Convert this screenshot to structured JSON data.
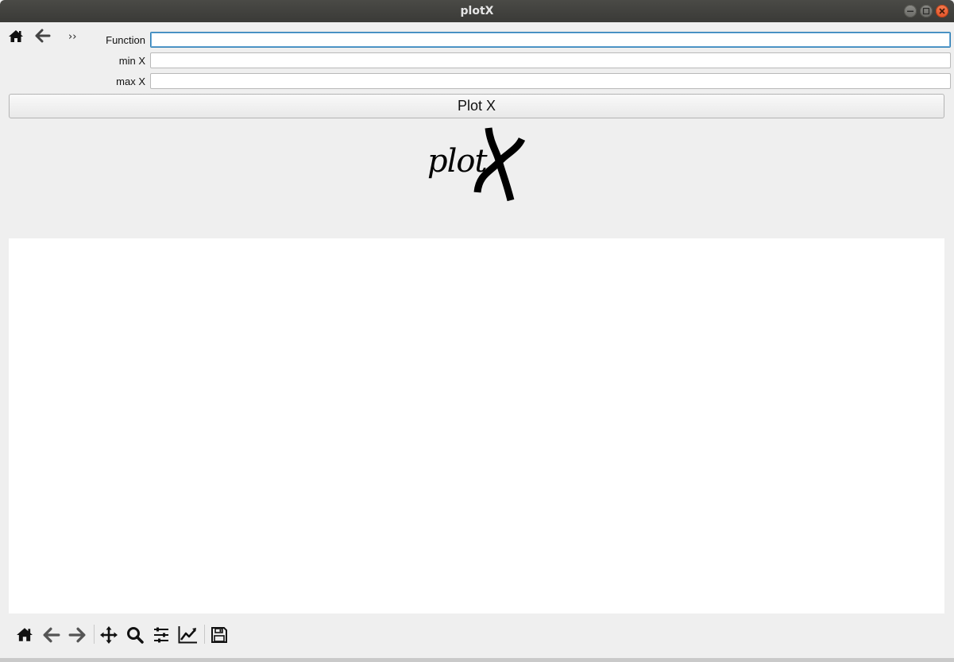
{
  "window": {
    "title": "plotX"
  },
  "top_toolbar": {
    "overflow_label": "››"
  },
  "form": {
    "function": {
      "label": "Function",
      "value": "",
      "placeholder": ""
    },
    "min_x": {
      "label": "min X",
      "value": "",
      "placeholder": ""
    },
    "max_x": {
      "label": "max X",
      "value": "",
      "placeholder": ""
    }
  },
  "plot_button": {
    "label": "Plot X"
  },
  "logo": {
    "text": "plot"
  },
  "icons": {
    "top": [
      "home-icon",
      "back-arrow-icon",
      "overflow-chevron-icon"
    ],
    "bottom": [
      "home-icon",
      "back-arrow-icon",
      "forward-arrow-icon",
      "pan-icon",
      "zoom-icon",
      "configure-subplots-icon",
      "edit-axes-icon",
      "save-icon"
    ]
  },
  "colors": {
    "titlebar": "#3e3e3b",
    "close_button": "#e95420",
    "background": "#efefef",
    "canvas": "#ffffff",
    "focus_border": "#2f7fb5"
  }
}
